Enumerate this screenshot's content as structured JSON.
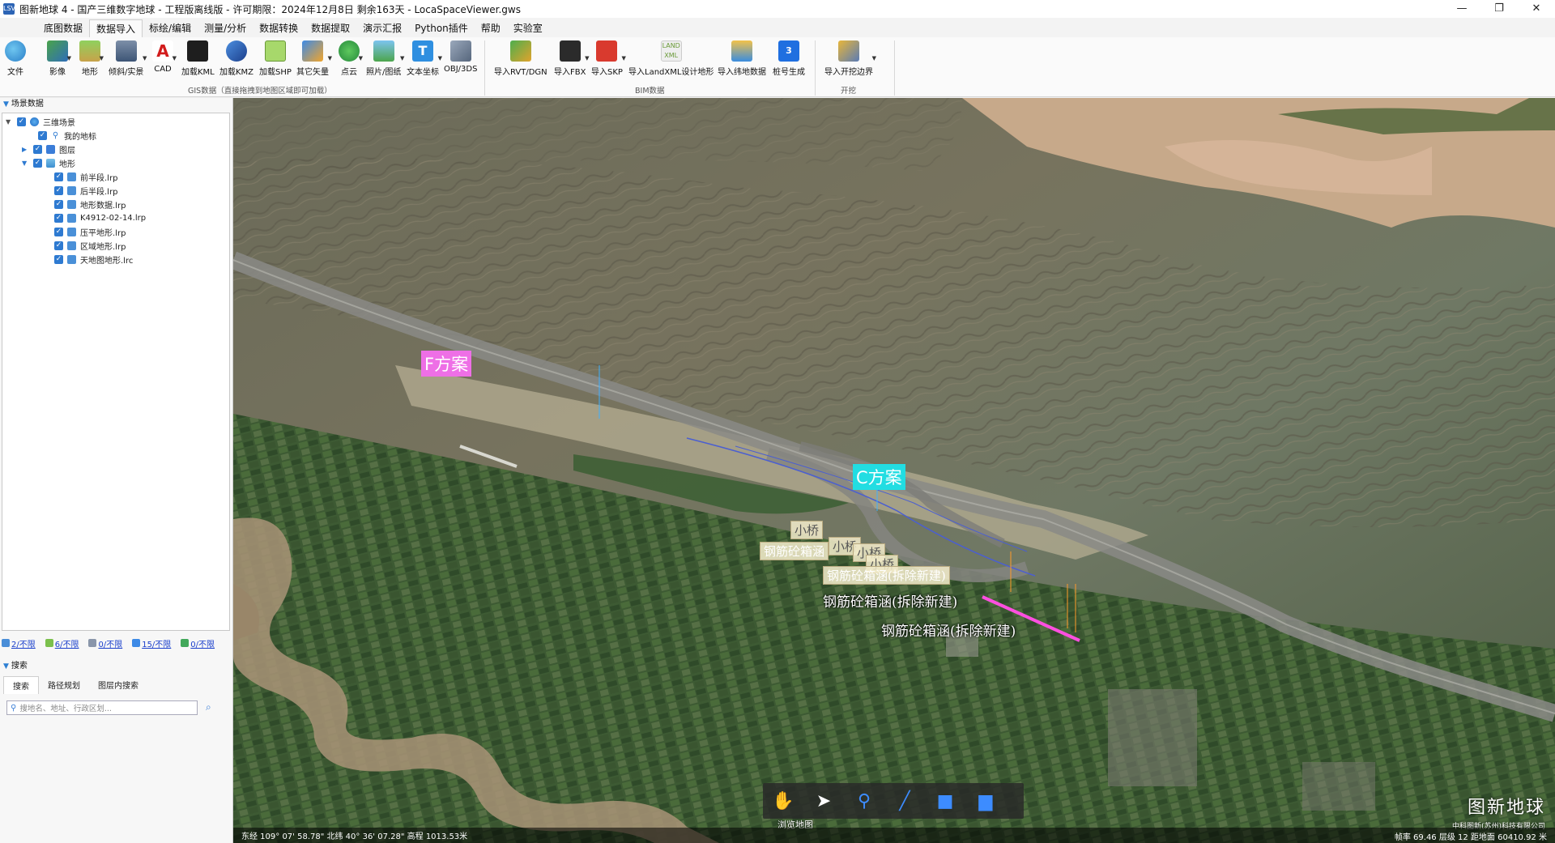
{
  "window": {
    "title": "图新地球 4 - 国产三维数字地球 - 工程版离线版 - 许可期限：2024年12月8日 剩余163天 - LocaSpaceViewer.gws",
    "app_icon": "LSV",
    "controls": [
      "—",
      "❐",
      "✕"
    ]
  },
  "menu": {
    "tabs": [
      "底图数据",
      "数据导入",
      "标绘/编辑",
      "测量/分析",
      "数据转换",
      "数据提取",
      "演示汇报",
      "Python插件",
      "帮助",
      "实验室"
    ],
    "active": "数据导入"
  },
  "ribbon": {
    "file": "文件",
    "gis_buttons": [
      "影像",
      "地形",
      "倾斜/实景",
      "CAD",
      "加载KML",
      "加载KMZ",
      "加载SHP",
      "其它矢量",
      "点云",
      "照片/图纸",
      "文本坐标",
      "OBJ/3DS"
    ],
    "gis_group": "GIS数据（直接拖拽到地图区域即可加载）",
    "bim_buttons": [
      "导入RVT/DGN",
      "导入FBX",
      "导入SKP",
      "导入LandXML设计地形",
      "导入纬地数据",
      "桩号生成"
    ],
    "bim_group": "BIM数据",
    "excavation_buttons": [
      "导入开挖边界"
    ],
    "excavation_group": "开挖"
  },
  "panel": {
    "header": "场景数据",
    "tree": {
      "root": "三维场景",
      "my_markers": "我的地标",
      "layers": "图层",
      "terrain": "地形",
      "terrain_items": [
        "前半段.lrp",
        "后半段.lrp",
        "地形数据.lrp",
        "K4912-02-14.lrp",
        "压平地形.lrp",
        "区域地形.lrp",
        "天地图地形.lrc"
      ]
    },
    "stats": [
      "2/不限",
      "6/不限",
      "0/不限",
      "15/不限",
      "0/不限"
    ],
    "search_header": "搜索",
    "search_tabs": [
      "搜索",
      "路径规划",
      "图层内搜索"
    ],
    "search_placeholder": "搜地名、地址、行政区划..."
  },
  "map": {
    "labels": {
      "plan_f": "F方案",
      "plan_c": "C方案",
      "bridge": "小桥",
      "culvert_short": "钢筋砼箱涵",
      "culvert_full": "钢筋砼箱涵(拆除新建)"
    },
    "toolbar_caption": "浏览地图",
    "brand_title": "图新地球",
    "brand_company": "中科图新(苏州)科技有限公司",
    "status_left": "东经 109° 07' 58.78\"  北纬 40° 36' 07.28\"   高程 1013.53米",
    "status_right": "帧率 69.46   层级 12   距地面 60410.92 米"
  },
  "colors": {
    "accent": "#2e7ad1",
    "plan_f": "#ee6fe6",
    "plan_c": "#22dde2",
    "road": "#8a8a86",
    "route_pink": "#ff4fe0"
  }
}
